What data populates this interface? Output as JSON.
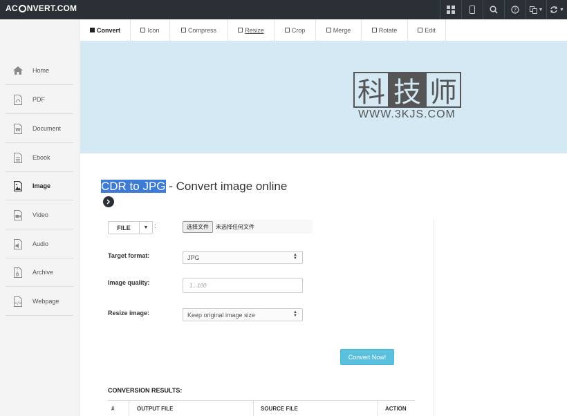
{
  "app": {
    "logo_left": "AC",
    "logo_right": "NVERT.COM"
  },
  "topbar": {
    "icons": [
      "apps-icon",
      "mobile-icon",
      "search-icon",
      "help-icon",
      "language-icon",
      "refresh-icon"
    ]
  },
  "sidebar": {
    "items": [
      {
        "label": "Home",
        "icon": "home-icon"
      },
      {
        "label": "PDF",
        "icon": "pdf-icon"
      },
      {
        "label": "Document",
        "icon": "document-icon"
      },
      {
        "label": "Ebook",
        "icon": "ebook-icon"
      },
      {
        "label": "Image",
        "icon": "image-icon",
        "active": true
      },
      {
        "label": "Video",
        "icon": "video-icon"
      },
      {
        "label": "Audio",
        "icon": "audio-icon"
      },
      {
        "label": "Archive",
        "icon": "archive-icon"
      },
      {
        "label": "Webpage",
        "icon": "webpage-icon"
      }
    ]
  },
  "tabs": [
    {
      "label": "Convert",
      "active": true
    },
    {
      "label": "Icon"
    },
    {
      "label": "Compress"
    },
    {
      "label": "Resize",
      "underline": true
    },
    {
      "label": "Crop"
    },
    {
      "label": "Merge"
    },
    {
      "label": "Rotate"
    },
    {
      "label": "Edit"
    }
  ],
  "banner": {
    "watermark_chars": [
      "科",
      "技",
      "师"
    ],
    "watermark_url": "WWW.3KJS.COM"
  },
  "heading": {
    "highlight": "CDR to JPG",
    "rest": " - Convert image online"
  },
  "form": {
    "file_button": "FILE",
    "colon": ":",
    "choose_file": "选择文件",
    "no_file": "未选择任何文件",
    "target_format_label": "Target format:",
    "target_format_value": "JPG",
    "quality_label": "Image quality:",
    "quality_placeholder": "1...100",
    "resize_label": "Resize image:",
    "resize_value": "Keep original image size",
    "convert_button": "Convert Now!"
  },
  "results": {
    "title": "CONVERSION RESULTS:",
    "columns": [
      "#",
      "OUTPUT FILE",
      "SOURCE FILE",
      "ACTION"
    ]
  }
}
